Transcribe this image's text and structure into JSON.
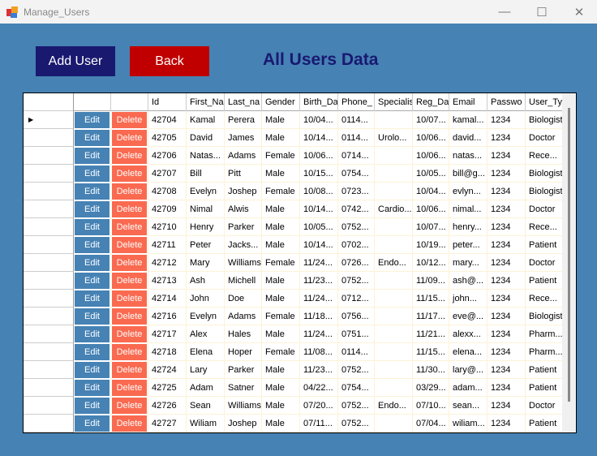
{
  "window": {
    "title": "Manage_Users",
    "minimize": "—",
    "maximize": "☐",
    "close": "✕"
  },
  "toolbar": {
    "add_user": "Add User",
    "back": "Back",
    "heading": "All Users Data"
  },
  "colors": {
    "add_user": "#191970",
    "back": "#c00000",
    "edit": "#4682b4",
    "delete": "#fa6a50"
  },
  "table": {
    "edit_label": "Edit",
    "delete_label": "Delete",
    "columns": [
      "Id",
      "First_Na",
      "Last_na",
      "Gender",
      "Birth_Da",
      "Phone_",
      "Specialis",
      "Reg_Da",
      "Email",
      "Passwo",
      "User_Ty"
    ],
    "rows": [
      [
        "42704",
        "Kamal",
        "Perera",
        "Male",
        "10/04...",
        "0114...",
        "",
        "10/07...",
        "kamal...",
        "1234",
        "Biologist"
      ],
      [
        "42705",
        "David",
        "James",
        "Male",
        "10/14...",
        "0114...",
        "Urolo...",
        "10/06...",
        "david...",
        "1234",
        "Doctor"
      ],
      [
        "42706",
        "Natas...",
        "Adams",
        "Female",
        "10/06...",
        "0714...",
        "",
        "10/06...",
        "natas...",
        "1234",
        "Rece..."
      ],
      [
        "42707",
        "Bill",
        "Pitt",
        "Male",
        "10/15...",
        "0754...",
        "",
        "10/05...",
        "bill@g...",
        "1234",
        "Biologist"
      ],
      [
        "42708",
        "Evelyn",
        "Joshep",
        "Female",
        "10/08...",
        "0723...",
        "",
        "10/04...",
        "evlyn...",
        "1234",
        "Biologist"
      ],
      [
        "42709",
        "Nimal",
        "Alwis",
        "Male",
        "10/14...",
        "0742...",
        "Cardio...",
        "10/06...",
        "nimal...",
        "1234",
        "Doctor"
      ],
      [
        "42710",
        "Henry",
        "Parker",
        "Male",
        "10/05...",
        "0752...",
        "",
        "10/07...",
        "henry...",
        "1234",
        "Rece..."
      ],
      [
        "42711",
        "Peter",
        "Jacks...",
        "Male",
        "10/14...",
        "0702...",
        "",
        "10/19...",
        "peter...",
        "1234",
        "Patient"
      ],
      [
        "42712",
        "Mary",
        "Williams",
        "Female",
        "11/24...",
        "0726...",
        "Endo...",
        "10/12...",
        "mary...",
        "1234",
        "Doctor"
      ],
      [
        "42713",
        "Ash",
        "Michell",
        "Male",
        "11/23...",
        "0752...",
        "",
        "11/09...",
        "ash@...",
        "1234",
        "Patient"
      ],
      [
        "42714",
        "John",
        "Doe",
        "Male",
        "11/24...",
        "0712...",
        "",
        "11/15...",
        "john...",
        "1234",
        "Rece..."
      ],
      [
        "42716",
        "Evelyn",
        "Adams",
        "Female",
        "11/18...",
        "0756...",
        "",
        "11/17...",
        "eve@...",
        "1234",
        "Biologist"
      ],
      [
        "42717",
        "Alex",
        "Hales",
        "Male",
        "11/24...",
        "0751...",
        "",
        "11/21...",
        "alexx...",
        "1234",
        "Pharm..."
      ],
      [
        "42718",
        "Elena",
        "Hoper",
        "Female",
        "11/08...",
        "0114...",
        "",
        "11/15...",
        "elena...",
        "1234",
        "Pharm..."
      ],
      [
        "42724",
        "Lary",
        "Parker",
        "Male",
        "11/23...",
        "0752...",
        "",
        "11/30...",
        "lary@...",
        "1234",
        "Patient"
      ],
      [
        "42725",
        "Adam",
        "Satner",
        "Male",
        "04/22...",
        "0754...",
        "",
        "03/29...",
        "adam...",
        "1234",
        "Patient"
      ],
      [
        "42726",
        "Sean",
        "Williams",
        "Male",
        "07/20...",
        "0752...",
        "Endo...",
        "07/10...",
        "sean...",
        "1234",
        "Doctor"
      ],
      [
        "42727",
        "Wiliam",
        "Joshep",
        "Male",
        "07/11...",
        "0752...",
        "",
        "07/04...",
        "wiliam...",
        "1234",
        "Patient"
      ]
    ]
  }
}
